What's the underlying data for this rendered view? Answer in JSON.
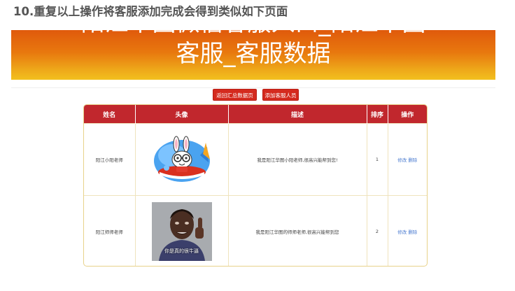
{
  "heading": "10.重复以上操作将客服添加完成会得到类似如下页面",
  "banner": {
    "line1": "阳江华图微信客服入口_阳江华图",
    "line2": "客服_客服数据"
  },
  "actions": {
    "back_label": "返回汇总数据页",
    "add_label": "添加客服人员"
  },
  "table": {
    "headers": [
      "姓名",
      "头像",
      "描述",
      "排序",
      "操作"
    ],
    "rows": [
      {
        "name": "阳江小阳老师",
        "avatar_icon": "cartoon-rabbit-surfing-avatar",
        "description": "我是阳江华图小阳老师,很高兴能帮到您!",
        "order": "1",
        "edit_label": "修改",
        "delete_label": "删除"
      },
      {
        "name": "阳江师师老师",
        "avatar_icon": "thumbs-up-man-photo-avatar",
        "avatar_caption": "你是真的很牛逼",
        "description": "我是阳江华图的师师老师,很高兴能帮到您",
        "order": "2",
        "edit_label": "修改",
        "delete_label": "删除"
      }
    ]
  },
  "colors": {
    "header_bg": "#c1272d",
    "button_bg": "#d42a1e",
    "link": "#4a7bd0",
    "banner_top": "#e05a0c",
    "banner_bottom": "#f2c01e"
  }
}
